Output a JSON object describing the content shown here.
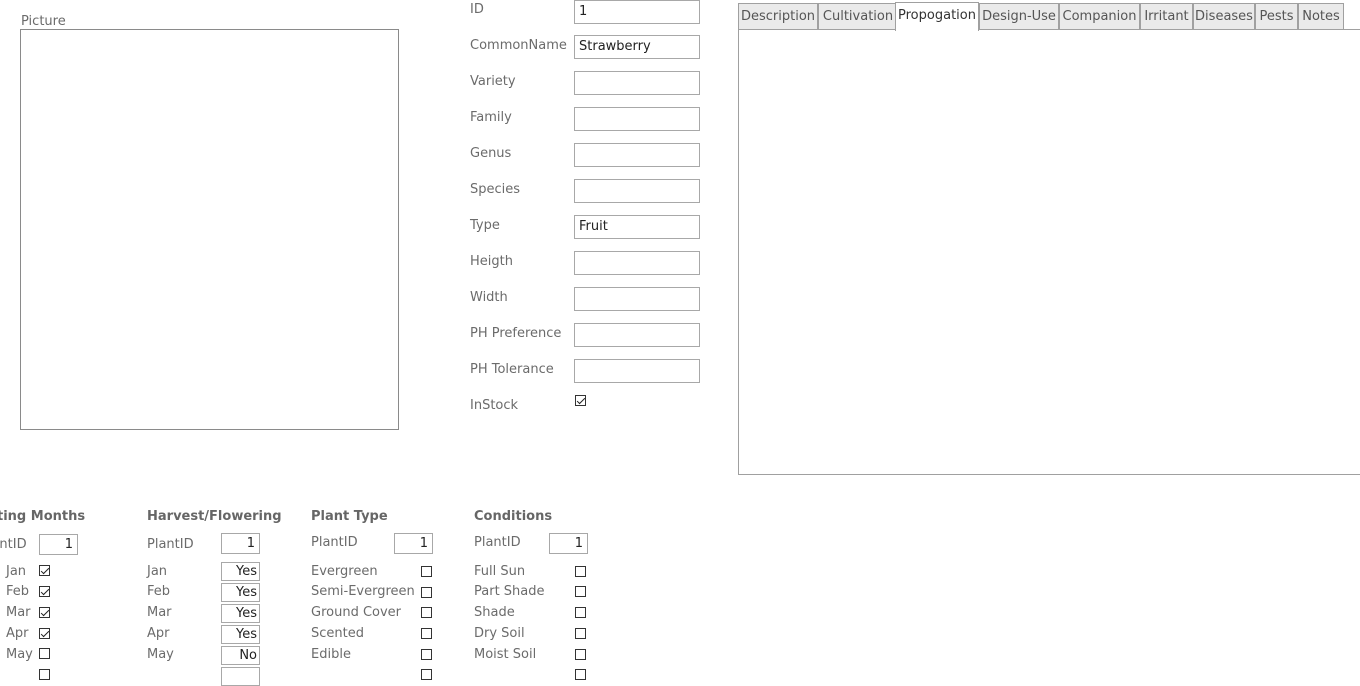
{
  "picture": {
    "label": "Picture"
  },
  "fields": [
    {
      "label": "ID",
      "value": "1"
    },
    {
      "label": "CommonName",
      "value": "Strawberry"
    },
    {
      "label": "Variety",
      "value": ""
    },
    {
      "label": "Family",
      "value": ""
    },
    {
      "label": "Genus",
      "value": ""
    },
    {
      "label": "Species",
      "value": ""
    },
    {
      "label": "Type",
      "value": "Fruit"
    },
    {
      "label": "Heigth",
      "value": ""
    },
    {
      "label": "Width",
      "value": ""
    },
    {
      "label": "PH Preference",
      "value": ""
    },
    {
      "label": "PH Tolerance",
      "value": ""
    }
  ],
  "instock": {
    "label": "InStock",
    "checked": true
  },
  "tabs": [
    {
      "label": "Description",
      "active": false
    },
    {
      "label": "Cultivation",
      "active": false
    },
    {
      "label": "Propogation",
      "active": true
    },
    {
      "label": "Design-Use",
      "active": false
    },
    {
      "label": "Companion",
      "active": false
    },
    {
      "label": "Irritant",
      "active": false
    },
    {
      "label": "Diseases",
      "active": false
    },
    {
      "label": "Pests",
      "active": false
    },
    {
      "label": "Notes",
      "active": false
    }
  ],
  "planting": {
    "title": "Planting Months",
    "id_label": "PlantID",
    "id_value": "1",
    "rows": [
      {
        "label": "Jan",
        "checked": true
      },
      {
        "label": "Feb",
        "checked": true
      },
      {
        "label": "Mar",
        "checked": true
      },
      {
        "label": "Apr",
        "checked": true
      },
      {
        "label": "May",
        "checked": false
      }
    ]
  },
  "harvest": {
    "title": "Harvest/Flowering",
    "id_label": "PlantID",
    "id_value": "1",
    "rows": [
      {
        "label": "Jan",
        "value": "Yes"
      },
      {
        "label": "Feb",
        "value": "Yes"
      },
      {
        "label": "Mar",
        "value": "Yes"
      },
      {
        "label": "Apr",
        "value": "Yes"
      },
      {
        "label": "May",
        "value": "No"
      }
    ]
  },
  "plant_type": {
    "title": "Plant Type",
    "id_label": "PlantID",
    "id_value": "1",
    "rows": [
      {
        "label": "Evergreen",
        "checked": false
      },
      {
        "label": "Semi-Evergreen",
        "checked": false
      },
      {
        "label": "Ground Cover",
        "checked": false
      },
      {
        "label": "Scented",
        "checked": false
      },
      {
        "label": "Edible",
        "checked": false
      }
    ]
  },
  "conditions": {
    "title": "Conditions",
    "id_label": "PlantID",
    "id_value": "1",
    "rows": [
      {
        "label": "Full Sun",
        "checked": false
      },
      {
        "label": "Part Shade",
        "checked": false
      },
      {
        "label": "Shade",
        "checked": false
      },
      {
        "label": "Dry Soil",
        "checked": false
      },
      {
        "label": "Moist Soil",
        "checked": false
      }
    ]
  }
}
